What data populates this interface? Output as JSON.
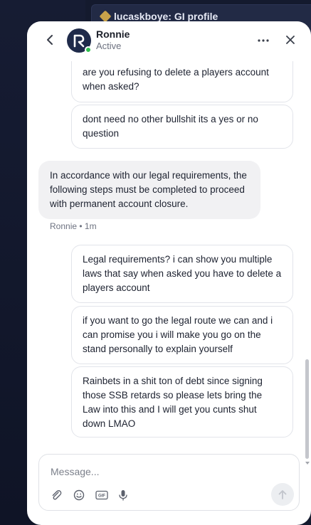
{
  "background": {
    "page_title": "lucaskboye: GI profile"
  },
  "header": {
    "agent_name": "Ronnie",
    "agent_status": "Active"
  },
  "messages": {
    "user_1": "are you refusing to delete a players account when asked?",
    "user_2": "dont need no other bullshit its a yes or no question",
    "agent_1": "In accordance with our legal requirements, the following steps must be completed to proceed with permanent account closure.",
    "agent_meta": "Ronnie • 1m",
    "user_3": "Legal requirements? i can show you multiple laws that say when asked you have to delete a players account",
    "user_4": "if you want to go the legal route we can and i can promise you i will make you go on the stand personally to explain yourself",
    "user_5": "Rainbets in a shit ton of debt since signing those SSB retards so please lets bring the Law into this and I will get you cunts shut down LMAO"
  },
  "composer": {
    "placeholder": "Message...",
    "tools": [
      "paperclip-icon",
      "emoji-icon",
      "gif-icon",
      "microphone-icon"
    ],
    "gif_label": "GIF"
  },
  "colors": {
    "status_online": "#2fbf4e",
    "agent_bubble": "#f1f1f3",
    "avatar_bg": "#1f2a4a"
  }
}
